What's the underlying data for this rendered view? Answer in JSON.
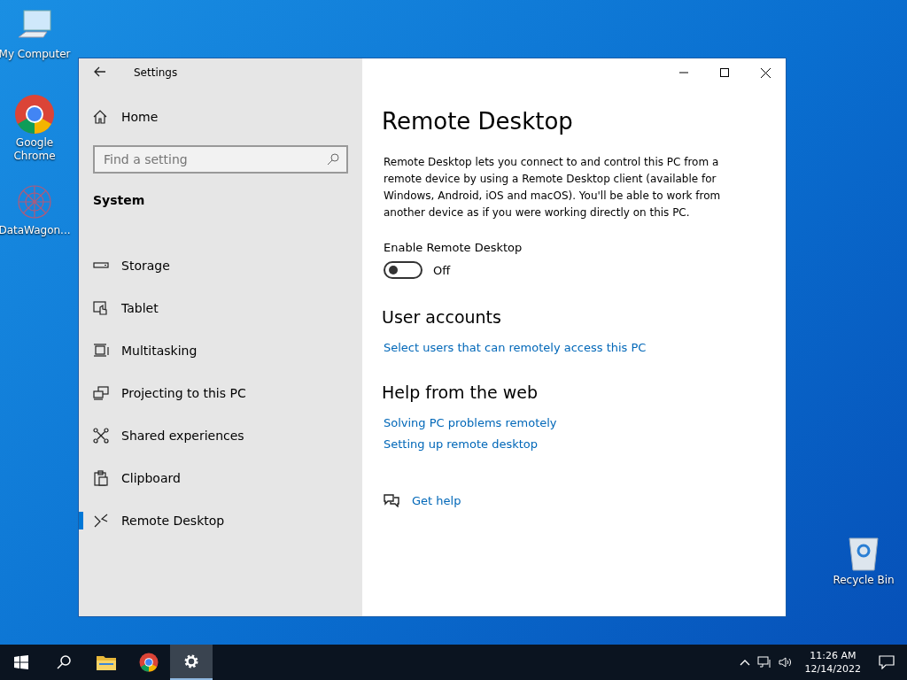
{
  "desktop_icons": [
    {
      "kind": "computer",
      "label": "My Computer"
    },
    {
      "kind": "chrome",
      "label": "Google Chrome"
    },
    {
      "kind": "datawagon",
      "label": "DataWagon..."
    },
    {
      "kind": "recycle",
      "label": "Recycle Bin"
    }
  ],
  "window": {
    "title": "Settings",
    "sidebar": {
      "home": "Home",
      "search": {
        "placeholder": "Find a setting"
      },
      "section": "System",
      "items": [
        {
          "kind": "storage",
          "label": "Storage",
          "selected": false
        },
        {
          "kind": "tablet",
          "label": "Tablet",
          "selected": false
        },
        {
          "kind": "multitasking",
          "label": "Multitasking",
          "selected": false
        },
        {
          "kind": "projecting",
          "label": "Projecting to this PC",
          "selected": false
        },
        {
          "kind": "shared",
          "label": "Shared experiences",
          "selected": false
        },
        {
          "kind": "clipboard",
          "label": "Clipboard",
          "selected": false
        },
        {
          "kind": "remote",
          "label": "Remote Desktop",
          "selected": true
        }
      ]
    },
    "content": {
      "title": "Remote Desktop",
      "description": "Remote Desktop lets you connect to and control this PC from a remote device by using a Remote Desktop client (available for Windows, Android, iOS and macOS). You'll be able to work from another device as if you were working directly on this PC.",
      "toggle": {
        "label": "Enable Remote Desktop",
        "on": false,
        "state_text": "Off"
      },
      "sections": [
        {
          "heading": "User accounts",
          "links": [
            "Select users that can remotely access this PC"
          ]
        },
        {
          "heading": "Help from the web",
          "links": [
            "Solving PC problems remotely",
            "Setting up remote desktop"
          ]
        }
      ],
      "get_help": "Get help"
    }
  },
  "taskbar": {
    "apps": [
      {
        "kind": "start",
        "selected": false
      },
      {
        "kind": "search",
        "selected": false
      },
      {
        "kind": "explorer",
        "selected": false
      },
      {
        "kind": "chrome",
        "selected": false
      },
      {
        "kind": "settings",
        "selected": true
      }
    ],
    "time": "11:26 AM",
    "date": "12/14/2022"
  }
}
